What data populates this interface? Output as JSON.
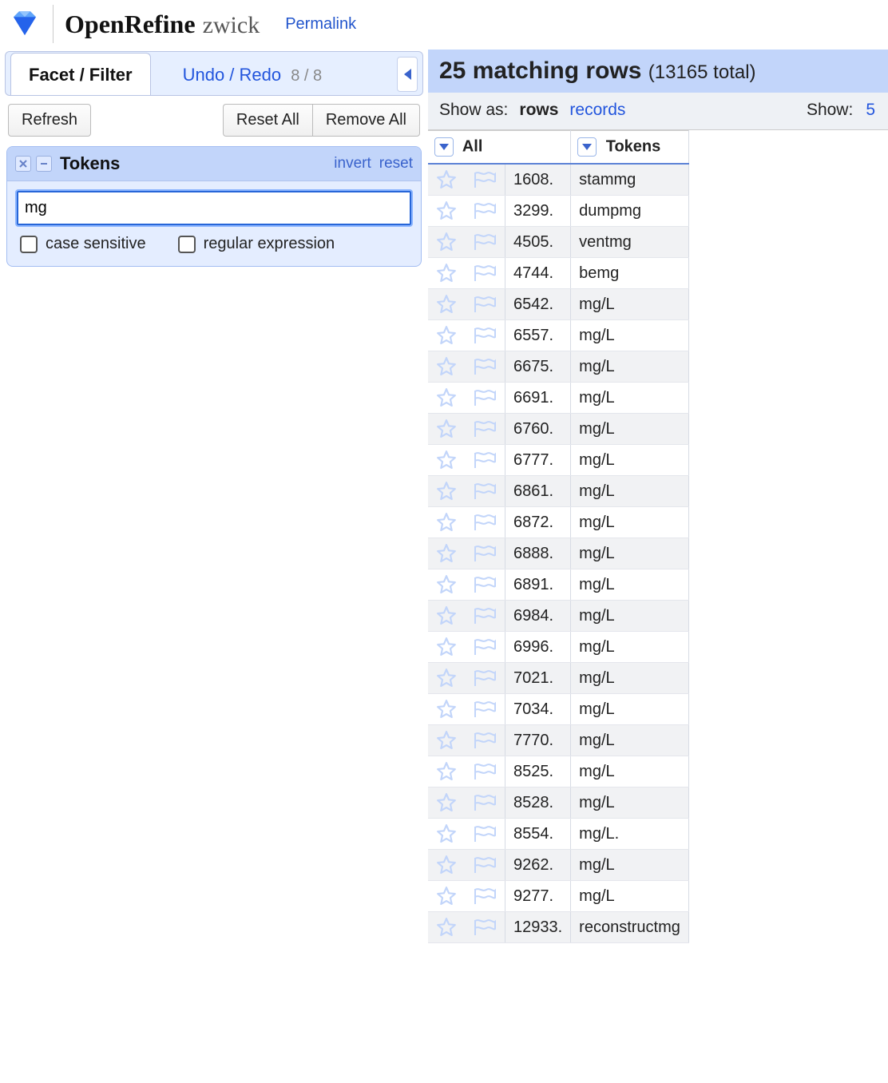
{
  "header": {
    "brand": "OpenRefine",
    "project_name": "zwick",
    "permalink_label": "Permalink"
  },
  "tabs": {
    "facet_filter": "Facet / Filter",
    "undo_redo": "Undo / Redo",
    "undo_redo_count": "8 / 8"
  },
  "toolbar": {
    "refresh": "Refresh",
    "reset_all": "Reset All",
    "remove_all": "Remove All"
  },
  "facet": {
    "name": "Tokens",
    "invert": "invert",
    "reset": "reset",
    "input_value": "mg",
    "case_sensitive": "case sensitive",
    "regex": "regular expression"
  },
  "summary": {
    "matching_count": "25",
    "matching_label": "matching rows",
    "total_count": "13165",
    "total_label_prefix": "(",
    "total_label_suffix": " total)"
  },
  "subbar": {
    "show_as": "Show as:",
    "rows": "rows",
    "records": "records",
    "show": "Show:",
    "page_size": "5"
  },
  "table": {
    "col_all": "All",
    "col_tokens": "Tokens",
    "rows": [
      {
        "idx": "1608.",
        "token": "stammg"
      },
      {
        "idx": "3299.",
        "token": "dumpmg"
      },
      {
        "idx": "4505.",
        "token": "ventmg"
      },
      {
        "idx": "4744.",
        "token": "bemg"
      },
      {
        "idx": "6542.",
        "token": "mg/L"
      },
      {
        "idx": "6557.",
        "token": "mg/L"
      },
      {
        "idx": "6675.",
        "token": "mg/L"
      },
      {
        "idx": "6691.",
        "token": "mg/L"
      },
      {
        "idx": "6760.",
        "token": "mg/L"
      },
      {
        "idx": "6777.",
        "token": "mg/L"
      },
      {
        "idx": "6861.",
        "token": "mg/L"
      },
      {
        "idx": "6872.",
        "token": "mg/L"
      },
      {
        "idx": "6888.",
        "token": "mg/L"
      },
      {
        "idx": "6891.",
        "token": "mg/L"
      },
      {
        "idx": "6984.",
        "token": "mg/L"
      },
      {
        "idx": "6996.",
        "token": "mg/L"
      },
      {
        "idx": "7021.",
        "token": "mg/L"
      },
      {
        "idx": "7034.",
        "token": "mg/L"
      },
      {
        "idx": "7770.",
        "token": "mg/L"
      },
      {
        "idx": "8525.",
        "token": "mg/L"
      },
      {
        "idx": "8528.",
        "token": "mg/L"
      },
      {
        "idx": "8554.",
        "token": "mg/L."
      },
      {
        "idx": "9262.",
        "token": "mg/L"
      },
      {
        "idx": "9277.",
        "token": "mg/L"
      },
      {
        "idx": "12933.",
        "token": "reconstructmg"
      }
    ]
  }
}
